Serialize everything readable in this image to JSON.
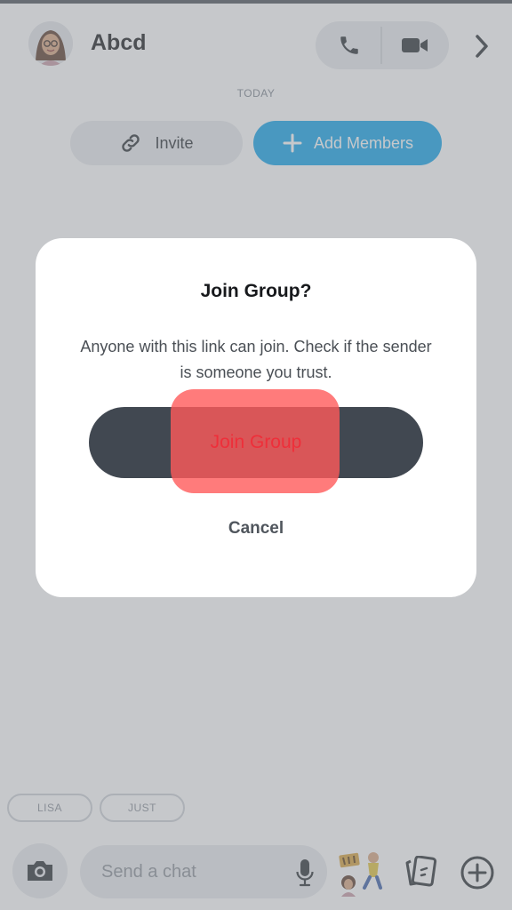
{
  "header": {
    "title": "Abcd",
    "avatar_icon": "bitmoji-avatar-icon",
    "call_icon": "phone-icon",
    "video_icon": "video-camera-icon",
    "more_icon": "chevron-right-icon"
  },
  "chat": {
    "day_label": "TODAY",
    "invite_label": "Invite",
    "invite_icon": "link-icon",
    "add_members_label": "Add Members",
    "add_members_icon": "plus-icon"
  },
  "quick_replies": [
    "LISA",
    "JUST"
  ],
  "composer": {
    "placeholder": "Send a chat",
    "camera_icon": "camera-icon",
    "mic_icon": "microphone-icon",
    "bitmoji_icon": "bitmoji-sticker-icon",
    "cards_icon": "cards-icon",
    "plus_icon": "plus-circle-icon"
  },
  "dialog": {
    "title": "Join Group?",
    "message": "Anyone with this link can join. Check if the sender is someone you trust.",
    "confirm_label": "Join Group",
    "cancel_label": "Cancel"
  },
  "colors": {
    "accent_blue": "#11a4ea",
    "dark_button": "#414851",
    "highlight_red": "#ff5a5a"
  }
}
